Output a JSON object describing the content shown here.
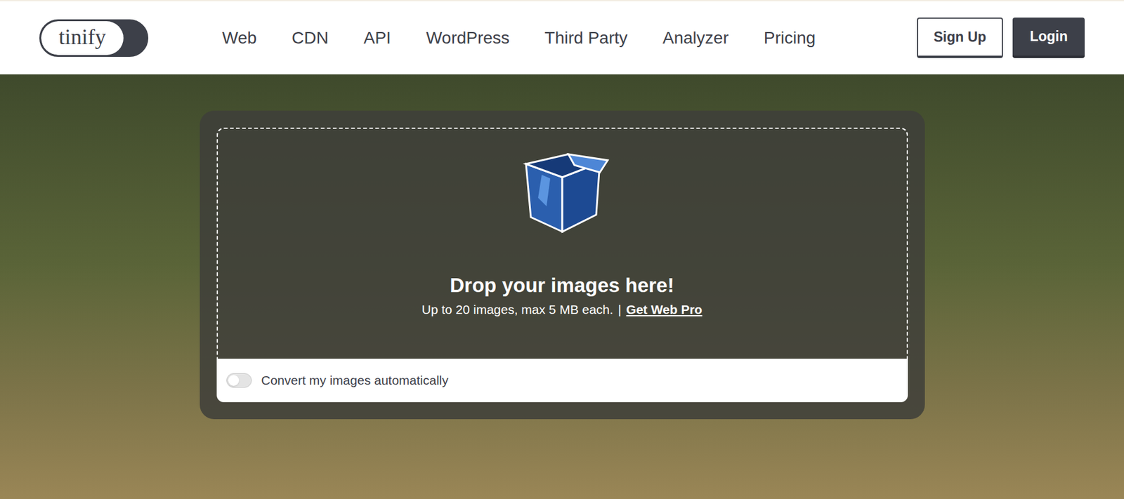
{
  "header": {
    "logo": "tinify",
    "nav": [
      "Web",
      "CDN",
      "API",
      "WordPress",
      "Third Party",
      "Analyzer",
      "Pricing"
    ],
    "buttons": [
      {
        "label": "Sign Up",
        "kind": "outline"
      },
      {
        "label": "Login",
        "kind": "solid"
      }
    ]
  },
  "dropzone": {
    "title": "Drop your images here!",
    "subtitle": "Up to 20 images, max 5 MB each.",
    "separator": "|",
    "link": "Get Web Pro"
  },
  "convert_toggle": {
    "label": "Convert my images automatically",
    "on": false
  }
}
